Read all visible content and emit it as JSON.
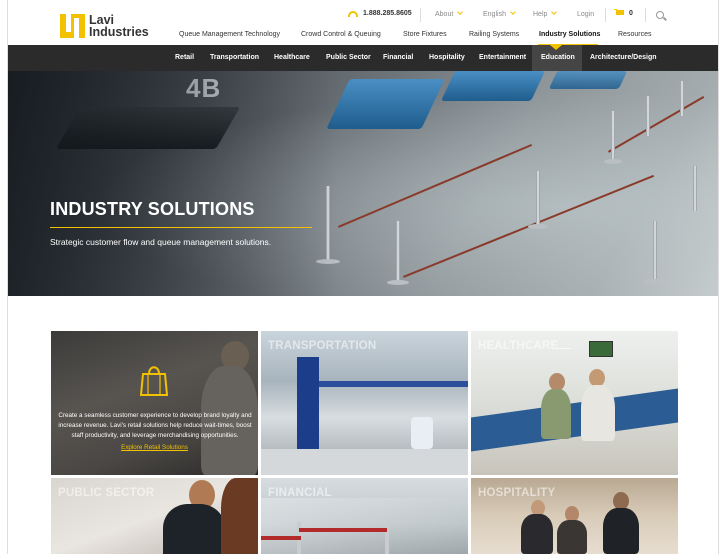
{
  "header": {
    "logo": {
      "line1": "Lavi",
      "line2": "Industries"
    },
    "phone": "1.888.285.8605",
    "utility_nav": [
      "About",
      "English",
      "Help",
      "Login"
    ],
    "cart_count": "0",
    "main_nav": [
      "Queue Management Technology",
      "Crowd Control & Queuing",
      "Store Fixtures",
      "Railing Systems",
      "Industry Solutions",
      "Resources"
    ],
    "main_nav_active": "Industry Solutions"
  },
  "subnav": {
    "items": [
      "Retail",
      "Transportation",
      "Healthcare",
      "Public Sector",
      "Financial",
      "Hospitality",
      "Entertainment",
      "Education",
      "Architecture/Design"
    ],
    "active": "Education"
  },
  "hero": {
    "sign": "4B",
    "title": "INDUSTRY SOLUTIONS",
    "subtitle": "Strategic customer flow and queue management solutions."
  },
  "tiles": {
    "retail": {
      "text": "Create a seamless customer experience to develop brand loyalty and increase revenue. Lavi's retail solutions help reduce wait-times, boost staff productivity, and leverage merchandising opportunities.",
      "link": "Explore Retail Solutions"
    },
    "transportation": {
      "label": "TRANSPORTATION"
    },
    "healthcare": {
      "label": "HEALTHCARE"
    },
    "public_sector": {
      "label": "PUBLIC SECTOR"
    },
    "financial": {
      "label": "FINANCIAL"
    },
    "hospitality": {
      "label": "HOSPITALITY"
    }
  },
  "colors": {
    "accent": "#f2c100",
    "subnav_bg": "#2b2b2b"
  }
}
